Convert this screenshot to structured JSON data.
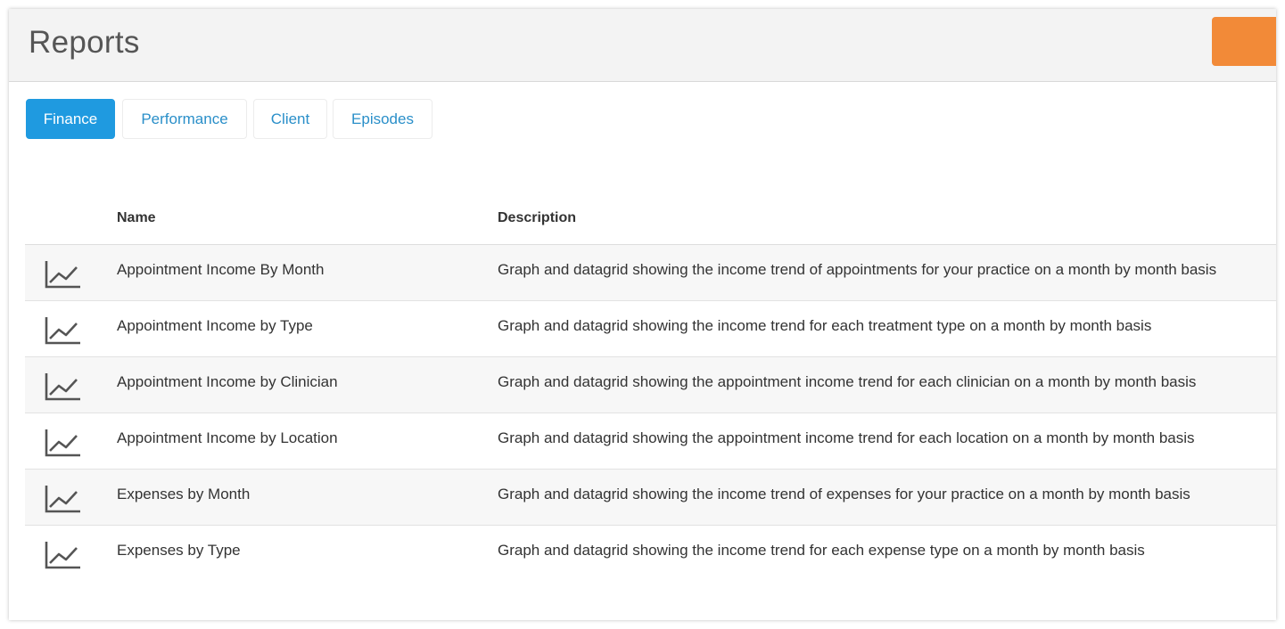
{
  "header": {
    "title": "Reports",
    "action_button_color": "#f28a38"
  },
  "tabs": [
    {
      "label": "Finance",
      "active": true
    },
    {
      "label": "Performance",
      "active": false
    },
    {
      "label": "Client",
      "active": false
    },
    {
      "label": "Episodes",
      "active": false
    }
  ],
  "table": {
    "columns": {
      "name": "Name",
      "description": "Description"
    },
    "rows": [
      {
        "icon": "line-chart-icon",
        "name": "Appointment Income By Month",
        "description": "Graph and datagrid showing the income trend of appointments for your practice on a month by month basis"
      },
      {
        "icon": "line-chart-icon",
        "name": "Appointment Income by Type",
        "description": "Graph and datagrid showing the income trend for each treatment type on a month by month basis"
      },
      {
        "icon": "line-chart-icon",
        "name": "Appointment Income by Clinician",
        "description": "Graph and datagrid showing the appointment income trend for each clinician on a month by month basis"
      },
      {
        "icon": "line-chart-icon",
        "name": "Appointment Income by Location",
        "description": "Graph and datagrid showing the appointment income trend for each location on a month by month basis"
      },
      {
        "icon": "line-chart-icon",
        "name": "Expenses by Month",
        "description": "Graph and datagrid showing the income trend of expenses for your practice on a month by month basis"
      },
      {
        "icon": "line-chart-icon",
        "name": "Expenses by Type",
        "description": "Graph and datagrid showing the income trend for each expense type on a month by month basis"
      }
    ]
  },
  "colors": {
    "accent": "#1f9ae0",
    "link": "#2a8fc9",
    "header_bg": "#f3f3f3"
  }
}
